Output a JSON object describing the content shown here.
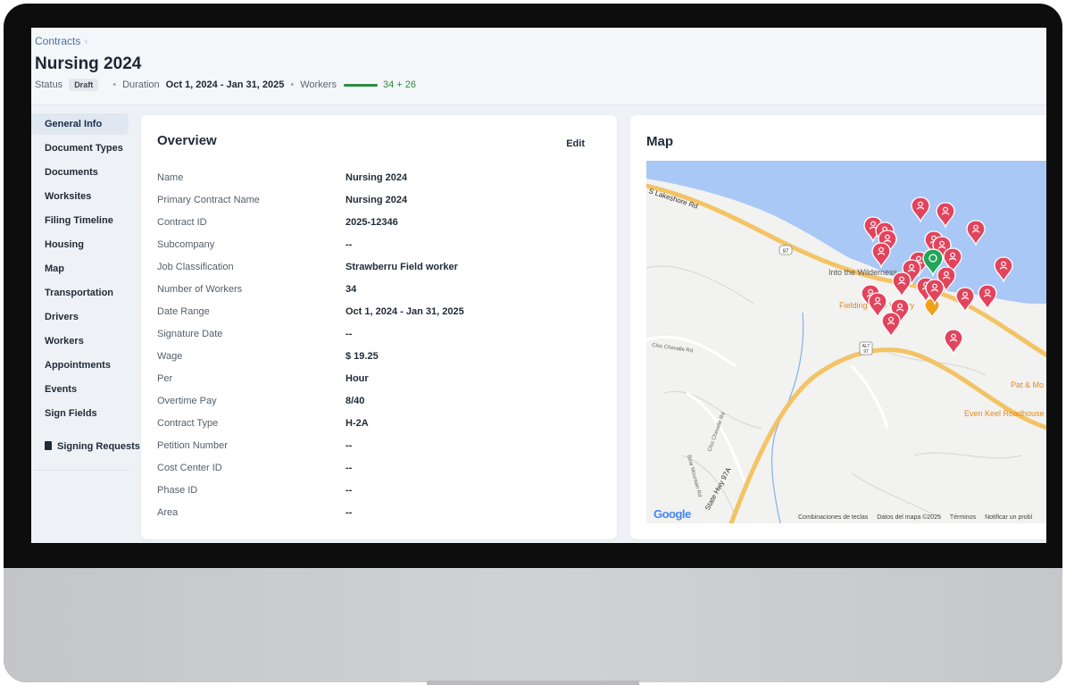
{
  "breadcrumb": {
    "parent": "Contracts",
    "chevron": "›"
  },
  "header": {
    "title": "Nursing 2024",
    "status_label": "Status",
    "status_value": "Draft",
    "duration_label": "Duration",
    "duration_value": "Oct 1, 2024 - Jan 31, 2025",
    "workers_label": "Workers",
    "workers_value": "34 + 26",
    "bullet": "•"
  },
  "sidebar": {
    "items": [
      {
        "label": "General Info"
      },
      {
        "label": "Document Types"
      },
      {
        "label": "Documents"
      },
      {
        "label": "Worksites"
      },
      {
        "label": "Filing Timeline"
      },
      {
        "label": "Housing"
      },
      {
        "label": "Map"
      },
      {
        "label": "Transportation"
      },
      {
        "label": "Drivers"
      },
      {
        "label": "Workers"
      },
      {
        "label": "Appointments"
      },
      {
        "label": "Events"
      },
      {
        "label": "Sign Fields"
      }
    ],
    "signing_requests": "Signing Requests"
  },
  "overview": {
    "title": "Overview",
    "edit_label": "Edit",
    "rows": [
      {
        "label": "Name",
        "value": "Nursing 2024"
      },
      {
        "label": "Primary Contract Name",
        "value": "Nursing 2024"
      },
      {
        "label": "Contract ID",
        "value": "2025-12346"
      },
      {
        "label": "Subcompany",
        "value": "--"
      },
      {
        "label": "Job Classification",
        "value": "Strawberru Field worker"
      },
      {
        "label": "Number of Workers",
        "value": "34"
      },
      {
        "label": "Date Range",
        "value": "Oct 1, 2024 - Jan 31, 2025"
      },
      {
        "label": "Signature Date",
        "value": "--"
      },
      {
        "label": "Wage",
        "value": "$ 19.25"
      },
      {
        "label": "Per",
        "value": "Hour"
      },
      {
        "label": "Overtime Pay",
        "value": "8/40"
      },
      {
        "label": "Contract Type",
        "value": "H-2A"
      },
      {
        "label": "Petition Number",
        "value": "--"
      },
      {
        "label": "Cost Center ID",
        "value": "--"
      },
      {
        "label": "Phase ID",
        "value": "--"
      },
      {
        "label": "Area",
        "value": "--"
      }
    ]
  },
  "map": {
    "title": "Map",
    "labels": {
      "road1": "S Lakeshore Rd",
      "shield1": "97",
      "shield2": "97",
      "shield2_top": "ALT",
      "place1": "Into the Wilderness",
      "place2": "Fielding Lake Winery",
      "road2": "Clos Chevalle Rd",
      "road3": "Clos Chevalle Rd",
      "road4": "Bear Mountain Rd",
      "hwy": "State Hwy 97A",
      "place3": "Pat & Mo",
      "place4": "Even Keel Roadhouse"
    },
    "footer": {
      "keys": "Combinaciones de teclas",
      "data": "Datos del mapa ©2025",
      "terms": "Términos",
      "report": "Notificar un probl"
    },
    "google": "Google",
    "colors": {
      "water": "#a9c8f5",
      "road": "#f3c465",
      "pin": "#e2445c",
      "pin_green": "#23a55a"
    }
  },
  "colors": {
    "accent": "#2e8b3c",
    "link": "#4a6fa5"
  }
}
